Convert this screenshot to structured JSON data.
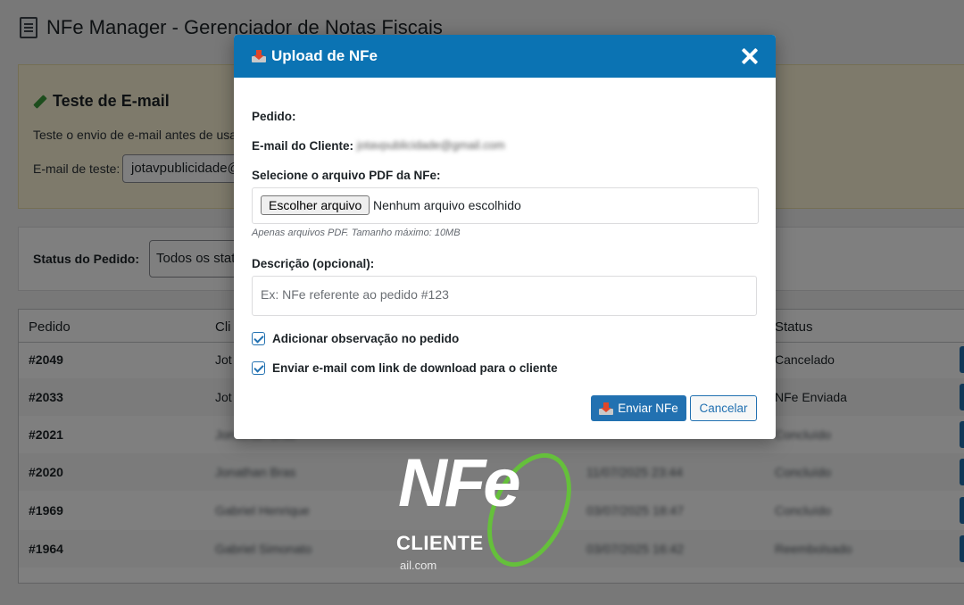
{
  "page": {
    "title": "NFe Manager - Gerenciador de Notas Fiscais"
  },
  "email_test": {
    "title": "Teste de E-mail",
    "description": "Teste o envio de e-mail antes de usa",
    "label": "E-mail de teste:",
    "value": "jotavpublicidade@"
  },
  "filter": {
    "label": "Status do Pedido:",
    "selected": "Todos os stat"
  },
  "table": {
    "headers": [
      "Pedido",
      "Cli",
      "Status"
    ],
    "rows": [
      {
        "order": "#2049",
        "client": "Jot",
        "date": "",
        "status": "Cancelado"
      },
      {
        "order": "#2033",
        "client": "Jot",
        "date": "",
        "status": "NFe Enviada"
      },
      {
        "order": "#2021",
        "client": "Jonathan Bras",
        "date": "",
        "status": "Concluído"
      },
      {
        "order": "#2020",
        "client": "Jonathan Bras",
        "date": "11/07/2025 23:44",
        "status": "Concluído"
      },
      {
        "order": "#1969",
        "client": "Gabriel Henrique",
        "date": "03/07/2025 18:47",
        "status": "Concluído"
      },
      {
        "order": "#1964",
        "client": "Gabriel Simonato",
        "date": "03/07/2025 16:42",
        "status": "Reembolsado"
      }
    ]
  },
  "modal": {
    "title": "Upload de NFe",
    "order_label": "Pedido:",
    "client_email_label": "E-mail do Cliente:",
    "client_email_value": "jotavpublicidade@gmail.com",
    "file_label": "Selecione o arquivo PDF da NFe:",
    "file_button": "Escolher arquivo",
    "file_status": "Nenhum arquivo escolhido",
    "file_hint": "Apenas arquivos PDF. Tamanho máximo: 10MB",
    "description_label": "Descrição (opcional):",
    "description_placeholder": "Ex: NFe referente ao pedido #123",
    "checkbox_note": "Adicionar observação no pedido",
    "checkbox_email": "Enviar e-mail com link de download para o cliente",
    "send_button": "Enviar NFe",
    "cancel_button": "Cancelar"
  },
  "logo": {
    "text": "NFe",
    "subtext": "CLIENTE",
    "fragment": "ail.com"
  },
  "colors": {
    "header_blue": "#0b73b3",
    "primary": "#2271b1",
    "notice_yellow": "#fcf4d6",
    "logo_green": "#65c03b"
  }
}
